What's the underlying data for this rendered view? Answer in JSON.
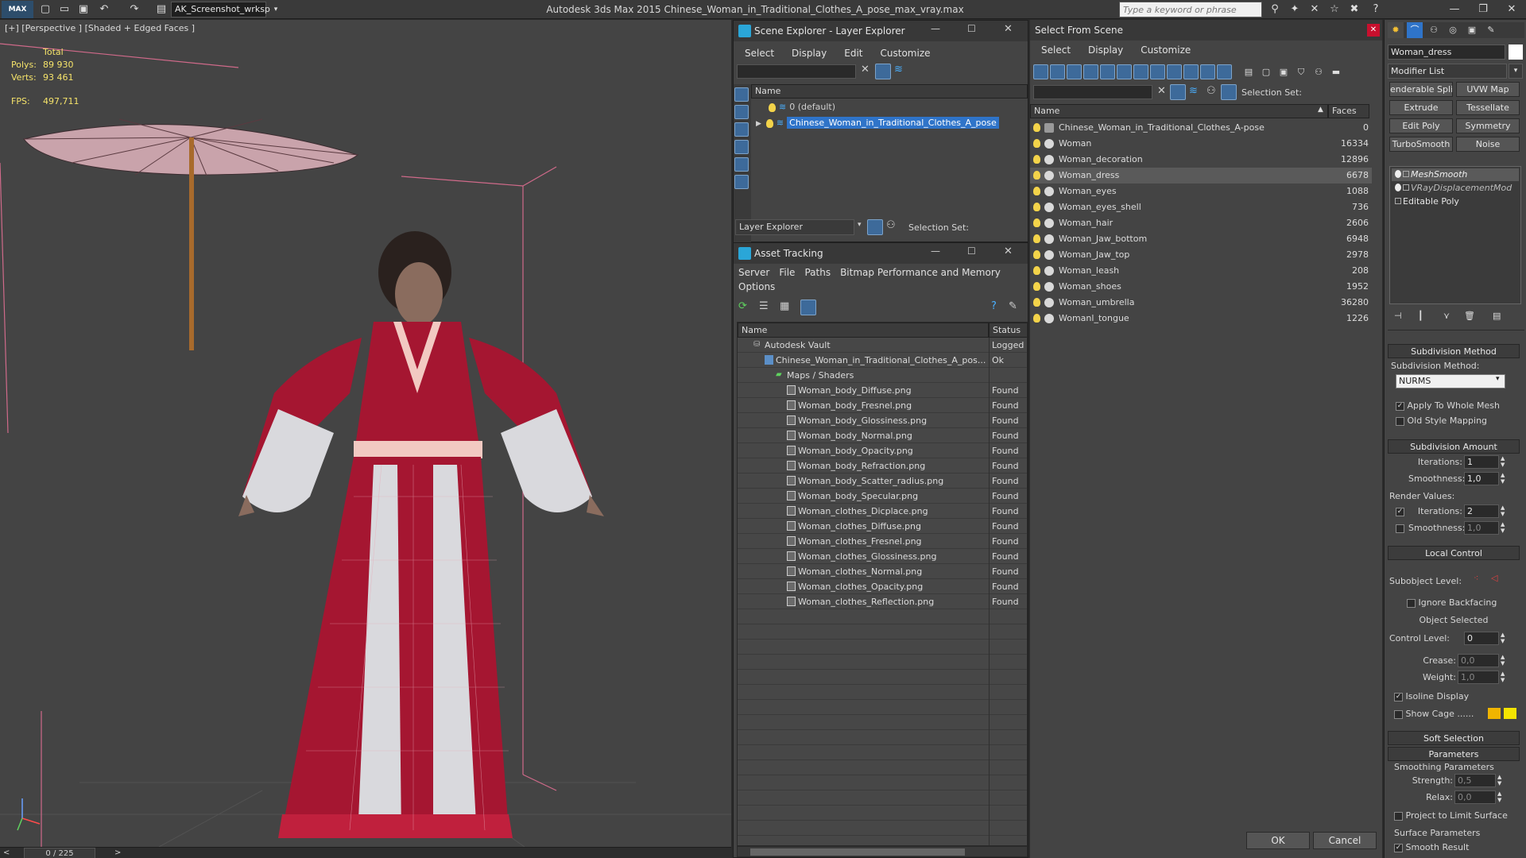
{
  "titlebar": {
    "logo": "MAX",
    "workspace": "AK_Screenshot_wrksp",
    "app_title": "Autodesk 3ds Max  2015     Chinese_Woman_in_Traditional_Clothes_A_pose_max_vray.max",
    "search_placeholder": "Type a keyword or phrase"
  },
  "viewport": {
    "label": "[+] [Perspective ] [Shaded + Edged Faces ]",
    "stats": {
      "total_label": "Total",
      "polys_label": "Polys:",
      "polys_value": "89 930",
      "verts_label": "Verts:",
      "verts_value": "93 461",
      "fps_label": "FPS:",
      "fps_value": "497,711"
    },
    "colors": {
      "dress_red": "#a51631",
      "dress_white": "#d9d9dd",
      "background": "#444444",
      "wire_pink": "#d06a8a"
    }
  },
  "timeslider": {
    "frame": "0 / 225",
    "prev": "<",
    "next": ">"
  },
  "scene_explorer": {
    "title": "Scene Explorer - Layer Explorer",
    "menu": [
      "Select",
      "Display",
      "Edit",
      "Customize"
    ],
    "column_name": "Name",
    "rows": [
      {
        "name": "0 (default)",
        "selected": false
      },
      {
        "name": "Chinese_Woman_in_Traditional_Clothes_A_pose",
        "selected": true
      }
    ],
    "footer_dropdown": "Layer Explorer",
    "selection_set_label": "Selection Set:"
  },
  "asset_tracking": {
    "title": "Asset Tracking",
    "menu": [
      "Server",
      "File",
      "Paths",
      "Bitmap Performance and Memory"
    ],
    "menu2": [
      "Options"
    ],
    "columns": [
      "Name",
      "Status"
    ],
    "rows": [
      {
        "name": "Autodesk Vault",
        "status": "Logged (",
        "indent": 1
      },
      {
        "name": "Chinese_Woman_in_Traditional_Clothes_A_pos...",
        "status": "Ok",
        "indent": 2
      },
      {
        "name": "Maps / Shaders",
        "status": "",
        "indent": 3
      },
      {
        "name": "Woman_body_Diffuse.png",
        "status": "Found",
        "indent": 4
      },
      {
        "name": "Woman_body_Fresnel.png",
        "status": "Found",
        "indent": 4
      },
      {
        "name": "Woman_body_Glossiness.png",
        "status": "Found",
        "indent": 4
      },
      {
        "name": "Woman_body_Normal.png",
        "status": "Found",
        "indent": 4
      },
      {
        "name": "Woman_body_Opacity.png",
        "status": "Found",
        "indent": 4
      },
      {
        "name": "Woman_body_Refraction.png",
        "status": "Found",
        "indent": 4
      },
      {
        "name": "Woman_body_Scatter_radius.png",
        "status": "Found",
        "indent": 4
      },
      {
        "name": "Woman_body_Specular.png",
        "status": "Found",
        "indent": 4
      },
      {
        "name": "Woman_clothes_Dicplace.png",
        "status": "Found",
        "indent": 4
      },
      {
        "name": "Woman_clothes_Diffuse.png",
        "status": "Found",
        "indent": 4
      },
      {
        "name": "Woman_clothes_Fresnel.png",
        "status": "Found",
        "indent": 4
      },
      {
        "name": "Woman_clothes_Glossiness.png",
        "status": "Found",
        "indent": 4
      },
      {
        "name": "Woman_clothes_Normal.png",
        "status": "Found",
        "indent": 4
      },
      {
        "name": "Woman_clothes_Opacity.png",
        "status": "Found",
        "indent": 4
      },
      {
        "name": "Woman_clothes_Reflection.png",
        "status": "Found",
        "indent": 4
      }
    ]
  },
  "select_from_scene": {
    "title": "Select From Scene",
    "menu": [
      "Select",
      "Display",
      "Customize"
    ],
    "selection_set_label": "Selection Set:",
    "columns": [
      "Name",
      "Faces"
    ],
    "rows": [
      {
        "name": "Chinese_Woman_in_Traditional_Clothes_A-pose",
        "faces": "0",
        "selected": false
      },
      {
        "name": "Woman",
        "faces": "16334",
        "selected": false
      },
      {
        "name": "Woman_decoration",
        "faces": "12896",
        "selected": false
      },
      {
        "name": "Woman_dress",
        "faces": "6678",
        "selected": true
      },
      {
        "name": "Woman_eyes",
        "faces": "1088",
        "selected": false
      },
      {
        "name": "Woman_eyes_shell",
        "faces": "736",
        "selected": false
      },
      {
        "name": "Woman_hair",
        "faces": "2606",
        "selected": false
      },
      {
        "name": "Woman_Jaw_bottom",
        "faces": "6948",
        "selected": false
      },
      {
        "name": "Woman_Jaw_top",
        "faces": "2978",
        "selected": false
      },
      {
        "name": "Woman_leash",
        "faces": "208",
        "selected": false
      },
      {
        "name": "Woman_shoes",
        "faces": "1952",
        "selected": false
      },
      {
        "name": "Woman_umbrella",
        "faces": "36280",
        "selected": false
      },
      {
        "name": "Womanl_tongue",
        "faces": "1226",
        "selected": false
      }
    ],
    "ok": "OK",
    "cancel": "Cancel"
  },
  "command_panel": {
    "object_name": "Woman_dress",
    "modifier_list": "Modifier List",
    "buttons": [
      "enderable Spli",
      "UVW Map",
      "Extrude",
      "Tessellate",
      "Edit Poly",
      "Symmetry",
      "TurboSmooth",
      "Noise"
    ],
    "stack": [
      "MeshSmooth",
      "VRayDisplacementMod",
      "Editable Poly"
    ],
    "subdivision_method_head": "Subdivision Method",
    "subdivision_method_label": "Subdivision Method:",
    "subdivision_method_value": "NURMS",
    "apply_whole_mesh": "Apply To Whole Mesh",
    "old_style_mapping": "Old Style Mapping",
    "subdivision_amount_head": "Subdivision Amount",
    "iterations_label": "Iterations:",
    "iterations_value": "1",
    "smoothness_label": "Smoothness:",
    "smoothness_value": "1,0",
    "render_values_label": "Render Values:",
    "render_iterations_value": "2",
    "render_smoothness_value": "1,0",
    "local_control_head": "Local Control",
    "subobject_level_label": "Subobject Level:",
    "ignore_backfacing": "Ignore Backfacing",
    "object_selected": "Object Selected",
    "control_level_label": "Control Level:",
    "control_level_value": "0",
    "crease_label": "Crease:",
    "crease_value": "0,0",
    "weight_label": "Weight:",
    "weight_value": "1,0",
    "isoline_display": "Isoline Display",
    "show_cage": "Show Cage ......",
    "cage_colors": [
      "#f0b400",
      "#f4e400"
    ],
    "soft_selection_head": "Soft Selection",
    "parameters_head": "Parameters",
    "smoothing_parameters": "Smoothing Parameters",
    "strength_label": "Strength:",
    "strength_value": "0,5",
    "relax_label": "Relax:",
    "relax_value": "0,0",
    "project_limit": "Project to Limit Surface",
    "surface_parameters": "Surface Parameters",
    "smooth_result": "Smooth Result"
  }
}
